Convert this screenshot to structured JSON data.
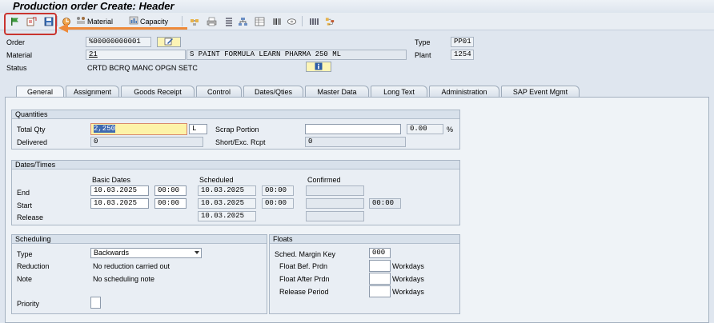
{
  "window": {
    "title": "Production order Create: Header"
  },
  "toolbar": {
    "material_label": "Material",
    "capacity_label": "Capacity",
    "icons": [
      "flag-icon",
      "release-icon",
      "save-icon",
      "component-icon",
      "material-icon",
      "capacity-icon",
      "operations-icon",
      "print-icon",
      "list-icon",
      "hierarchy-icon",
      "table-icon",
      "barcode-icon",
      "cost-icon",
      "grid-icon",
      "network-icon"
    ]
  },
  "header": {
    "order_label": "Order",
    "order_value": "%00000000001",
    "type_label": "Type",
    "type_value": "PP01",
    "material_label": "Material",
    "material_value": "21",
    "material_desc": "S PAINT FORMULA LEARN PHARMA 250 ML",
    "plant_label": "Plant",
    "plant_value": "1254",
    "status_label": "Status",
    "status_value": "CRTD BCRQ MANC OPGN SETC"
  },
  "tabs": [
    {
      "label": "General"
    },
    {
      "label": "Assignment"
    },
    {
      "label": "Goods Receipt"
    },
    {
      "label": "Control"
    },
    {
      "label": "Dates/Qties"
    },
    {
      "label": "Master Data"
    },
    {
      "label": "Long Text"
    },
    {
      "label": "Administration"
    },
    {
      "label": "SAP Event Mgmt"
    }
  ],
  "quantities": {
    "title": "Quantities",
    "total_qty_label": "Total Qty",
    "total_qty_value": "2,250",
    "unit": "L",
    "scrap_label": "Scrap Portion",
    "scrap_value": "",
    "scrap_pct": "0.00",
    "pct_sign": "%",
    "delivered_label": "Delivered",
    "delivered_value": "0",
    "short_label": "Short/Exc. Rcpt",
    "short_value": "0"
  },
  "dates": {
    "title": "Dates/Times",
    "col_basic": "Basic Dates",
    "col_scheduled": "Scheduled",
    "col_confirmed": "Confirmed",
    "end_label": "End",
    "start_label": "Start",
    "release_label": "Release",
    "end_basic_date": "10.03.2025",
    "end_basic_time": "00:00",
    "end_sched_date": "10.03.2025",
    "end_sched_time": "00:00",
    "start_basic_date": "10.03.2025",
    "start_basic_time": "00:00",
    "start_sched_date": "10.03.2025",
    "start_sched_time": "00:00",
    "start_conf_time": "00:00",
    "release_sched_date": "10.03.2025"
  },
  "scheduling": {
    "title": "Scheduling",
    "type_label": "Type",
    "type_value": "Backwards",
    "reduction_label": "Reduction",
    "reduction_value": "No reduction carried out",
    "note_label": "Note",
    "note_value": "No scheduling note",
    "priority_label": "Priority"
  },
  "floats": {
    "title": "Floats",
    "margin_key_label": "Sched. Margin Key",
    "margin_key_value": "000",
    "float_bef_label": "Float Bef. Prdn",
    "float_after_label": "Float After Prdn",
    "release_period_label": "Release Period",
    "workdays": "Workdays"
  },
  "colors": {
    "highlight": "#c9342f",
    "arrow": "#ee8a3a",
    "input_yellow": "#fdf3a8"
  }
}
